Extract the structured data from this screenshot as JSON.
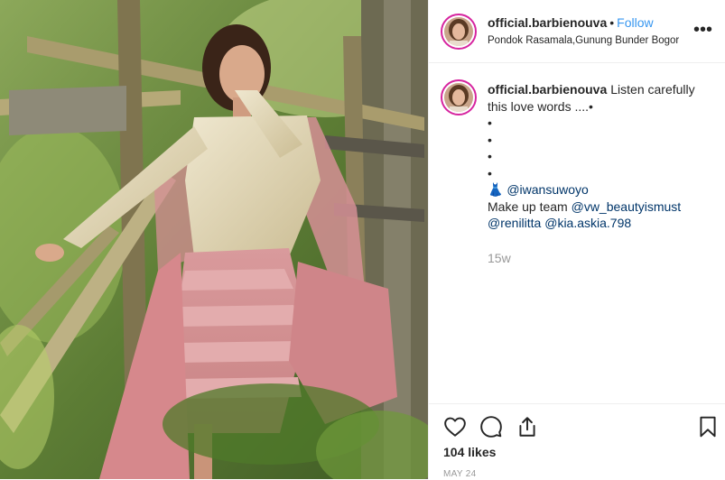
{
  "post": {
    "photo_alt": "Woman in a lace kebaya and pink tiered skirt posing on a wooden bamboo staircase in a forest"
  },
  "header": {
    "username": "official.barbienouva",
    "separator": "•",
    "follow_label": "Follow",
    "location": "Pondok Rasamala,Gunung Bunder Bogor",
    "more_label": "•••"
  },
  "caption": {
    "username": "official.barbienouva",
    "text": "Listen carefully this love words ....•",
    "bullets": [
      "•",
      "•",
      "•",
      "•"
    ],
    "credit_emoji": "👗",
    "credit_handle": "@iwansuwoyo",
    "makeup_label": "Make up team",
    "makeup_handle_1": "@vw_beautyismust",
    "makeup_handle_2": "@renilitta",
    "makeup_handle_3": "@kia.askia.798",
    "time_ago": "15w"
  },
  "actions": {
    "like_icon": "heart-icon",
    "comment_icon": "comment-icon",
    "share_icon": "share-icon",
    "save_icon": "bookmark-icon",
    "likes": "104 likes",
    "date": "MAY 24"
  },
  "colors": {
    "link": "#3897f0",
    "mention": "#003569",
    "muted": "#999999",
    "text": "#262626"
  }
}
